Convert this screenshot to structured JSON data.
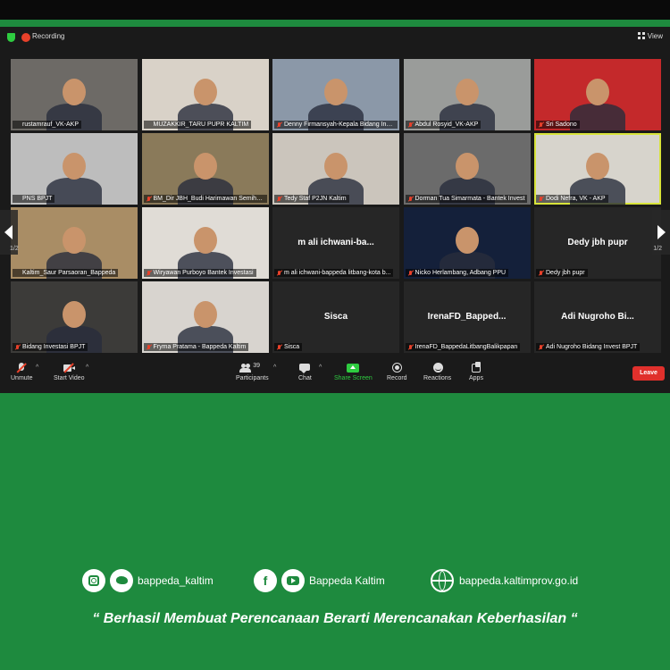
{
  "window": {
    "recording_label": "Recording",
    "view_label": "View",
    "page_indicator": "1/2"
  },
  "participants": [
    {
      "name": "rustamrauf_VK-AKP",
      "muted": false,
      "type": "video",
      "bg": "#6d6a66"
    },
    {
      "name": "MUZAKKIR_TARU PUPR KALTIM",
      "muted": false,
      "type": "video",
      "bg": "#d9d2c8"
    },
    {
      "name": "Denny Firmansyah-Kepala Bidang Investa...",
      "muted": true,
      "type": "video",
      "bg": "#8b98a8"
    },
    {
      "name": "Abdul Rosyid_VK-AKP",
      "muted": true,
      "type": "video",
      "bg": "#9a9c9a"
    },
    {
      "name": "Sri Sadono",
      "muted": true,
      "type": "video",
      "bg": "#c4292b"
    },
    {
      "name": "PNS BPJT",
      "muted": false,
      "type": "video",
      "bg": "#bdbdbd"
    },
    {
      "name": "BM_Dir JBH_Budi Harimawan Semihar...",
      "muted": true,
      "type": "video",
      "bg": "#8a7a5a"
    },
    {
      "name": "Tedy Staf P2JN Kaltim",
      "muted": true,
      "type": "video",
      "bg": "#cbc5bc"
    },
    {
      "name": "Dorman Tua Simarmata - Bantek Invest",
      "muted": true,
      "type": "video",
      "bg": "#6b6b6b"
    },
    {
      "name": "Dodi Nefra, VK - AKP",
      "muted": true,
      "type": "video",
      "bg": "#d7d4cc",
      "active": true
    },
    {
      "name": "Kaltim_Saur Parsaoran_Bappeda",
      "muted": false,
      "type": "video",
      "bg": "#a98d65"
    },
    {
      "name": "Wiryawan Purboyo Bantek Investasi",
      "muted": true,
      "type": "video",
      "bg": "#e0dcd6"
    },
    {
      "name": "m ali ichwani-bappeda litbang-kota b...",
      "muted": true,
      "type": "text",
      "big": "m ali ichwani-ba..."
    },
    {
      "name": "Nicko Herlambang, Adbang PPU",
      "muted": true,
      "type": "video",
      "bg": "#14203a"
    },
    {
      "name": "Dedy jbh pupr",
      "muted": true,
      "type": "text",
      "big": "Dedy jbh pupr"
    },
    {
      "name": "Bidang Investasi BPJT",
      "muted": true,
      "type": "video",
      "bg": "#3c3b39"
    },
    {
      "name": "Fryma Pratama - Bappeda Kaltim",
      "muted": true,
      "type": "video",
      "bg": "#d8d4cf"
    },
    {
      "name": "Sisca",
      "muted": true,
      "type": "text",
      "big": "Sisca"
    },
    {
      "name": "IrenaFD_BappedaLitbangBalikpapan",
      "muted": true,
      "type": "text",
      "big": "IrenaFD_Bapped..."
    },
    {
      "name": "Adi Nugroho Bidang Invest BPJT",
      "muted": true,
      "type": "text",
      "big": "Adi Nugroho Bi..."
    }
  ],
  "toolbar": {
    "unmute": "Unmute",
    "start_video": "Start Video",
    "participants": "Participants",
    "participants_count": "39",
    "chat": "Chat",
    "share_screen": "Share Screen",
    "record": "Record",
    "reactions": "Reactions",
    "apps": "Apps",
    "leave": "Leave"
  },
  "footer": {
    "handle": "bappeda_kaltim",
    "page_name": "Bappeda Kaltim",
    "website": "bappeda.kaltimprov.go.id",
    "tagline": "“ Berhasil  Membuat Perencanaan Berarti Merencanakan Keberhasilan “"
  },
  "colors": {
    "background_green": "#1e8a3e",
    "zoom_dark": "#1a1a1a",
    "leave_red": "#e0302c",
    "share_green": "#2ecc40",
    "active_speaker": "#d8e43a"
  }
}
